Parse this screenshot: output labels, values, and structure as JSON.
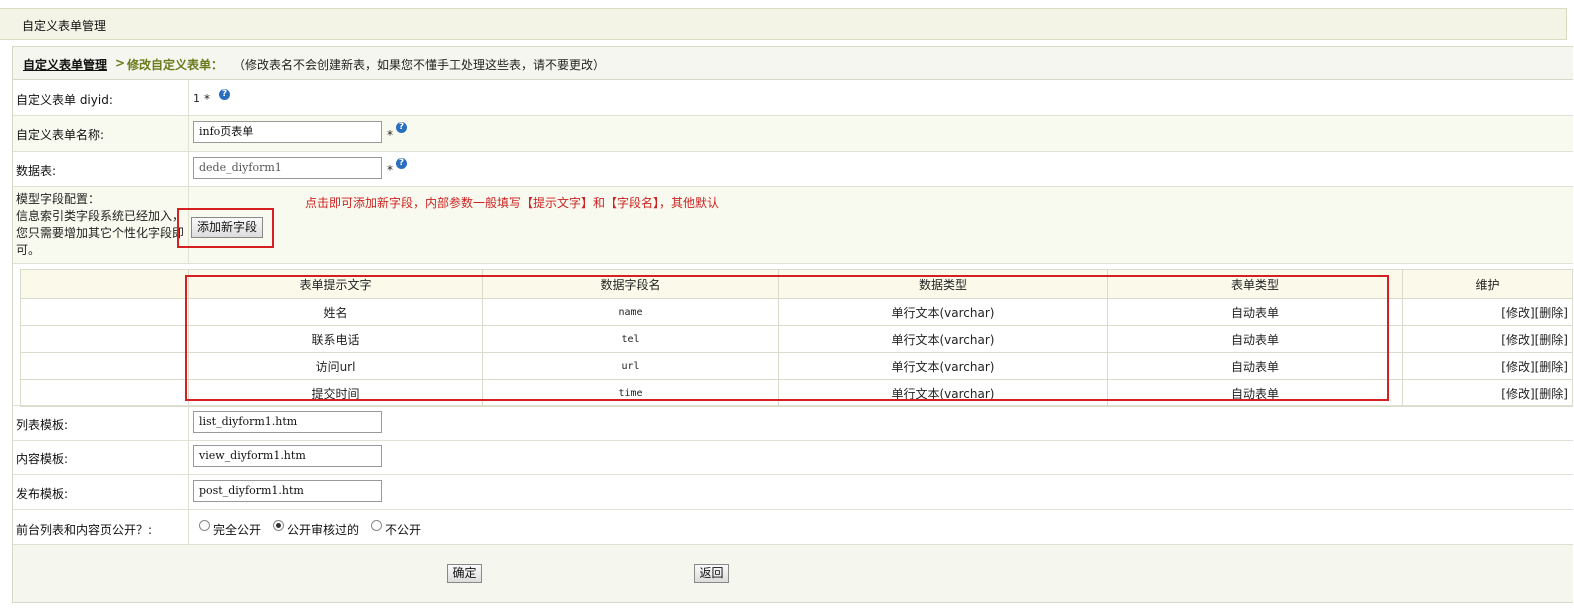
{
  "page_title": "自定义表单管理",
  "breadcrumb": {
    "home": "自定义表单管理",
    "arrow": ">",
    "current": "修改自定义表单：",
    "note": "（修改表名不会创建新表，如果您不懂手工处理这些表，请不要更改）"
  },
  "form": {
    "diyid_label": "自定义表单 diyid:",
    "diyid_value": "1",
    "name_label": "自定义表单名称:",
    "name_value": "info页表单",
    "table_label": "数据表:",
    "table_value": "dede_diyform1",
    "required_mark": "*",
    "help_icon_glyph": "?",
    "model_label": "模型字段配置：",
    "model_desc": "信息索引类字段系统已经加入，您只需要增加其它个性化字段即可。",
    "add_field_button": "添加新字段",
    "add_field_hint": "点击即可添加新字段，内部参数一般填写【提示文字】和【字段名】，其他默认",
    "list_tpl_label": "列表模板:",
    "list_tpl_value": "list_diyform1.htm",
    "view_tpl_label": "内容模板:",
    "view_tpl_value": "view_diyform1.htm",
    "post_tpl_label": "发布模板:",
    "post_tpl_value": "post_diyform1.htm",
    "public_label": "前台列表和内容页公开？:",
    "public_options": [
      "完全公开",
      "公开审核过的",
      "不公开"
    ],
    "public_selected_index": 1,
    "ok_button": "确定",
    "back_button": "返回"
  },
  "fields_table": {
    "headers": [
      "表单提示文字",
      "数据字段名",
      "数据类型",
      "表单类型",
      "维护"
    ],
    "rows": [
      [
        "姓名",
        "name",
        "单行文本(varchar)",
        "自动表单",
        "[修改][删除]"
      ],
      [
        "联系电话",
        "tel",
        "单行文本(varchar)",
        "自动表单",
        "[修改][删除]"
      ],
      [
        "访问url",
        "url",
        "单行文本(varchar)",
        "自动表单",
        "[修改][删除]"
      ],
      [
        "提交时间",
        "time",
        "单行文本(varchar)",
        "自动表单",
        "[修改][删除]"
      ]
    ]
  },
  "colors": {
    "highlight_red": "#d42020",
    "hint_red": "#cc2222",
    "breadcrumb_green": "#6b7a1c",
    "help_blue": "#2a6ebd"
  }
}
